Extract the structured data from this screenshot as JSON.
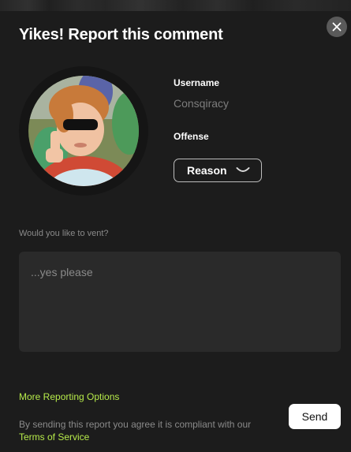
{
  "dialog": {
    "title": "Yikes! Report this comment",
    "close_icon": "close-icon"
  },
  "user": {
    "username_label": "Username",
    "username_value": "Consqiracy",
    "avatar_icon": "avatar"
  },
  "offense": {
    "label": "Offense",
    "selected": "Reason",
    "dropdown_icon": "chevron-down-icon"
  },
  "vent": {
    "label": "Would you like to vent?",
    "placeholder": "...yes please",
    "value": ""
  },
  "footer": {
    "more_options": "More Reporting Options",
    "disclaimer_prefix": "By sending this report you agree it is compliant with our ",
    "tos_link": "Terms of Service",
    "send_label": "Send"
  },
  "colors": {
    "background": "#1c1c1c",
    "accent": "#b6ea4a",
    "input_bg": "#2a2a2a",
    "muted_text": "#8a8a8a"
  }
}
